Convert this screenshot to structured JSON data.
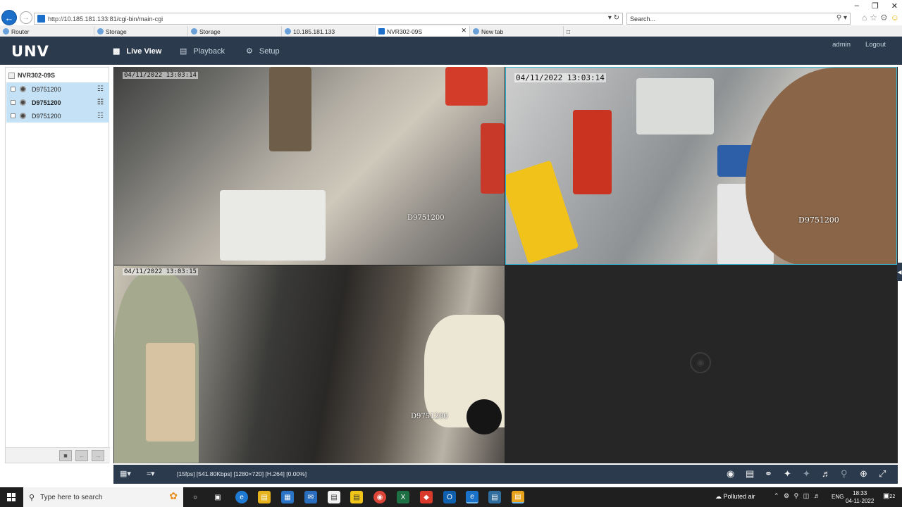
{
  "browser": {
    "url": "http://10.185.181.133:81/cgi-bin/main-cgi",
    "search_placeholder": "Search...",
    "tabs": [
      {
        "label": "Router"
      },
      {
        "label": "Storage"
      },
      {
        "label": "Storage"
      },
      {
        "label": "10.185.181.133"
      },
      {
        "label": "NVR302-09S",
        "active": true
      },
      {
        "label": "New tab"
      }
    ]
  },
  "app": {
    "logo": "UNV",
    "nav": [
      {
        "label": "Live View",
        "active": true,
        "icon": "monitor-icon"
      },
      {
        "label": "Playback",
        "icon": "film-icon"
      },
      {
        "label": "Setup",
        "icon": "gear-icon"
      }
    ],
    "user": "admin",
    "logout": "Logout"
  },
  "sidebar": {
    "device": "NVR302-09S",
    "cameras": [
      {
        "name": "D9751200",
        "bold": false
      },
      {
        "name": "D9751200",
        "bold": true
      },
      {
        "name": "D9751200",
        "bold": false
      }
    ]
  },
  "tiles": [
    {
      "timestamp": "04/11/2022 13:03:14",
      "label": "D9751200"
    },
    {
      "timestamp": "04/11/2022 13:03:14",
      "label": "D9751200"
    },
    {
      "timestamp": "04/11/2022 13:03:15",
      "label": "D9751200"
    },
    {
      "timestamp": "",
      "label": ""
    }
  ],
  "toolbar": {
    "stream_info": "[15fps] [541.80Kbps] [1280×720] [H.264] [0.00%]"
  },
  "taskbar": {
    "search_placeholder": "Type here to search",
    "weather": "Polluted air",
    "lang": "ENG",
    "time": "18:33",
    "date": "04-11-2022",
    "notif_count": "22"
  }
}
